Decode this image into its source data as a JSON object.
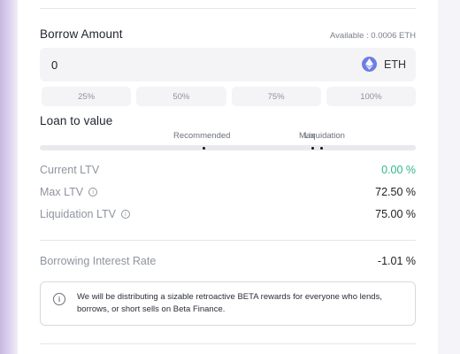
{
  "borrow": {
    "title": "Borrow Amount",
    "available": "Available : 0.0006 ETH",
    "amount_value": "0",
    "token": "ETH",
    "percent_buttons": [
      "25%",
      "50%",
      "75%",
      "100%"
    ]
  },
  "ltv": {
    "title": "Loan to value",
    "slider_labels": {
      "recommended": "Recommended",
      "max": "Max",
      "liquidation": "Liquidation"
    },
    "rows": [
      {
        "label": "Current LTV",
        "value": "0.00 %"
      },
      {
        "label": "Max LTV",
        "value": "72.50 %"
      },
      {
        "label": "Liquidation LTV",
        "value": "75.00 %"
      }
    ]
  },
  "interest": {
    "label": "Borrowing Interest Rate",
    "value": "-1.01 %"
  },
  "notice": {
    "text": "We will be distributing a sizable retroactive BETA rewards for everyone who lends, borrows, or short sells on Beta Finance."
  },
  "colors": {
    "positive": "#2eb88a",
    "eth": "#6c7ee1"
  },
  "icons": {
    "info": "ⓘ"
  }
}
